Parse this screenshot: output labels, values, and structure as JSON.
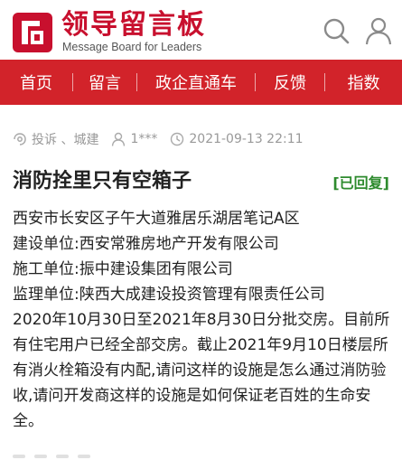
{
  "header": {
    "title": "领导留言板",
    "subtitle": "Message Board for Leaders",
    "brand_color": "#c8102e",
    "logo_icon": "red-square-bracket-logo-icon",
    "search_icon": "search-icon",
    "user_icon": "user-icon"
  },
  "nav": {
    "background": "#d2232a",
    "items": [
      {
        "label": "首页"
      },
      {
        "label": "留言"
      },
      {
        "label": "政企直通车"
      },
      {
        "label": "反馈"
      },
      {
        "label": "指数"
      }
    ]
  },
  "message": {
    "category": "投诉 、城建",
    "author": "1***",
    "datetime": "2021-09-13 22:11",
    "title": "消防拴里只有空箱子",
    "status": "[已回复]",
    "status_color": "#2e8b2e",
    "lines": [
      "西安市长安区子午大道雅居乐湖居笔记A区",
      "建设单位:西安常雅房地产开发有限公司",
      "施工单位:振中建设集团有限公司",
      "监理单位:陕西大成建设投资管理有限责任公司",
      "2020年10月30日至2021年8月30日分批交房。目前所有住宅用户已经全部交房。截止2021年9月10日楼层所有消火栓箱没有内配,请问这样的设施是怎么通过消防验收,请问开发商这样的设施是如何保证老百姓的生命安全。"
    ]
  }
}
